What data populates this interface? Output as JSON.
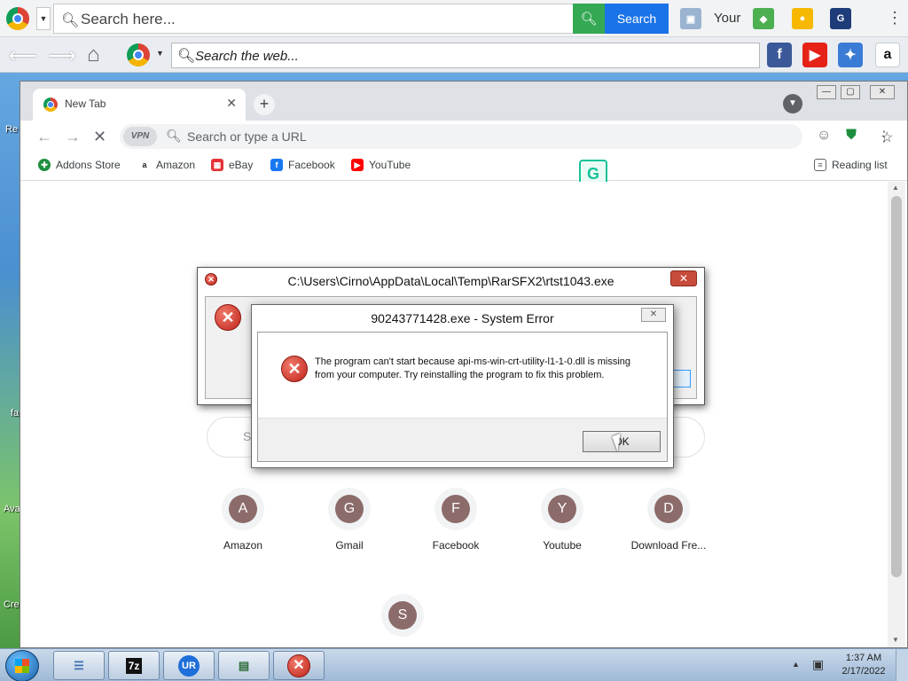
{
  "toolbar1": {
    "search_placeholder": "Search here...",
    "search_button": "Search",
    "your_label": "Your"
  },
  "toolbar2": {
    "search_placeholder": "Search the web..."
  },
  "desktop_labels": [
    "Re",
    "fa",
    "Ava",
    "Cre"
  ],
  "browser": {
    "tab_title": "New Tab",
    "vpn_label": "VPN",
    "omnibox_placeholder": "Search or type a URL",
    "bookmarks": [
      {
        "label": "Addons Store",
        "icon": "addons-icon",
        "color": "#1e8e3e"
      },
      {
        "label": "Amazon",
        "icon": "amazon-icon",
        "color": "#222222"
      },
      {
        "label": "eBay",
        "icon": "ebay-icon",
        "color": "#e53238"
      },
      {
        "label": "Facebook",
        "icon": "facebook-icon",
        "color": "#1877f2"
      },
      {
        "label": "YouTube",
        "icon": "youtube-icon",
        "color": "#ff0000"
      }
    ],
    "reading_list": "Reading list",
    "search_box_letter": "S",
    "shortcuts": [
      {
        "letter": "A",
        "label": "Amazon"
      },
      {
        "letter": "G",
        "label": "Gmail"
      },
      {
        "letter": "F",
        "label": "Facebook"
      },
      {
        "letter": "Y",
        "label": "Youtube"
      },
      {
        "letter": "D",
        "label": "Download Fre..."
      }
    ],
    "extra_shortcut_letter": "S"
  },
  "dialog_back": {
    "title": "C:\\Users\\Cirno\\AppData\\Local\\Temp\\RarSFX2\\rtst1043.exe"
  },
  "dialog_front": {
    "title": "90243771428.exe - System Error",
    "message": "The program can't start because api-ms-win-crt-utility-l1-1-0.dll is missing from your computer. Try reinstalling the program to fix this problem.",
    "ok_label": "OK"
  },
  "taskbar": {
    "time": "1:37 AM",
    "date": "2/17/2022",
    "apps": [
      "task-list-icon",
      "7zip-icon",
      "ur-browser-icon",
      "window-app-icon",
      "error-app-icon"
    ]
  }
}
